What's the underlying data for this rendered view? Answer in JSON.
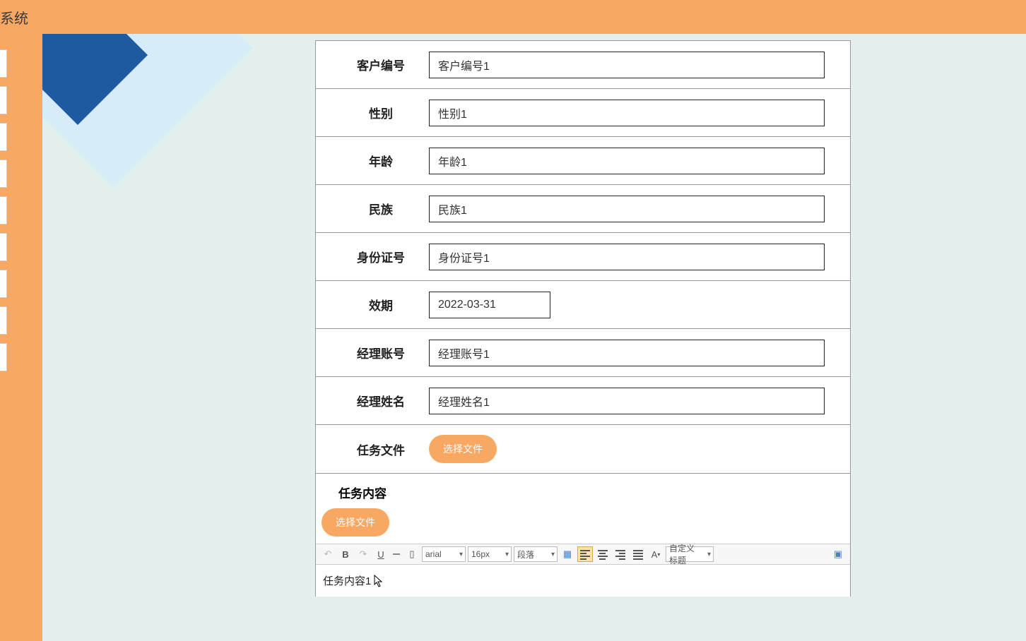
{
  "header": {
    "title": "系统"
  },
  "form": {
    "rows": [
      {
        "label": "客户编号",
        "value": "客户编号1",
        "type": "text"
      },
      {
        "label": "性别",
        "value": "性别1",
        "type": "text"
      },
      {
        "label": "年龄",
        "value": "年龄1",
        "type": "text"
      },
      {
        "label": "民族",
        "value": "民族1",
        "type": "text"
      },
      {
        "label": "身份证号",
        "value": "身份证号1",
        "type": "text"
      },
      {
        "label": "效期",
        "value": "2022-03-31",
        "type": "date"
      },
      {
        "label": "经理账号",
        "value": "经理账号1",
        "type": "text"
      },
      {
        "label": "经理姓名",
        "value": "经理姓名1",
        "type": "text"
      }
    ],
    "file_row": {
      "label": "任务文件",
      "button": "选择文件"
    },
    "content_row": {
      "label": "任务内容",
      "button": "选择文件",
      "body": "任务内容1"
    }
  },
  "editor": {
    "font_family": "arial",
    "font_size": "16px",
    "paragraph": "段落",
    "custom_title": "自定义标题"
  }
}
